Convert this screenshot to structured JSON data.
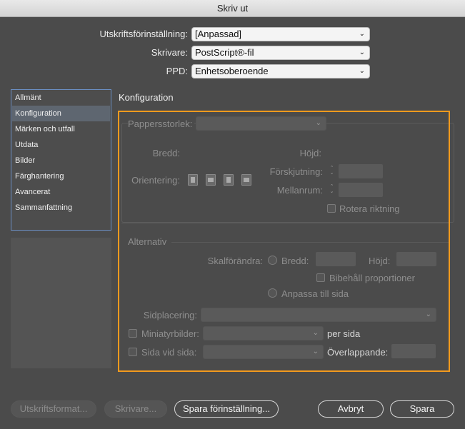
{
  "window": {
    "title": "Skriv ut"
  },
  "top": {
    "preset_label": "Utskriftsförinställning:",
    "preset_value": "[Anpassad]",
    "printer_label": "Skrivare:",
    "printer_value": "PostScript®-fil",
    "ppd_label": "PPD:",
    "ppd_value": "Enhetsoberoende"
  },
  "sidebar": {
    "items": [
      {
        "label": "Allmänt"
      },
      {
        "label": "Konfiguration"
      },
      {
        "label": "Märken och utfall"
      },
      {
        "label": "Utdata"
      },
      {
        "label": "Bilder"
      },
      {
        "label": "Färghantering"
      },
      {
        "label": "Avancerat"
      },
      {
        "label": "Sammanfattning"
      }
    ],
    "selected_index": 1
  },
  "section": {
    "title": "Konfiguration",
    "paper": {
      "size_label": "Pappersstorlek:",
      "size_value": "",
      "width_label": "Bredd:",
      "height_label": "Höjd:",
      "orientation_label": "Orientering:",
      "offset_label": "Förskjutning:",
      "gap_label": "Mellanrum:",
      "rotate_label": "Rotera riktning"
    },
    "options": {
      "title": "Alternativ",
      "scale_label": "Skalförändra:",
      "scale_width_label": "Bredd:",
      "scale_height_label": "Höjd:",
      "keep_proportions_label": "Bibehåll proportioner",
      "fit_to_page_label": "Anpassa till sida",
      "page_position_label": "Sidplacering:",
      "thumbnails_label": "Miniatyrbilder:",
      "per_page_label": "per sida",
      "tile_label": "Sida vid sida:",
      "overlap_label": "Överlappande:"
    }
  },
  "buttons": {
    "page_setup": "Utskriftsformat...",
    "printer": "Skrivare...",
    "save_preset": "Spara förinställning...",
    "cancel": "Avbryt",
    "save": "Spara"
  },
  "colors": {
    "highlight": "#f39a1d",
    "sidebar_border": "#6b8fc4"
  }
}
